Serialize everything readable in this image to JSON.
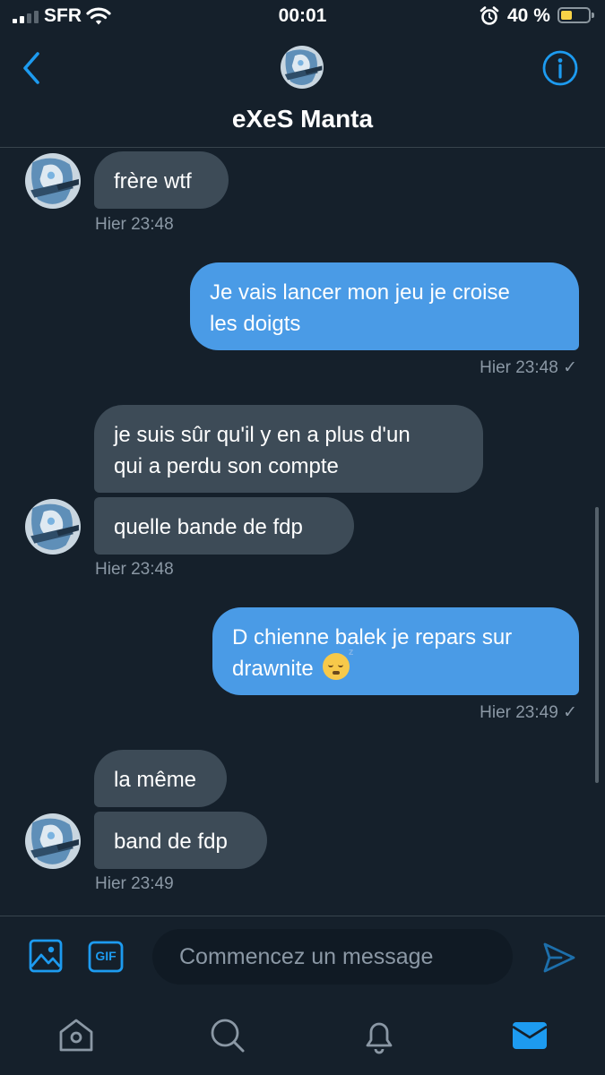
{
  "status_bar": {
    "carrier": "SFR",
    "time": "00:01",
    "battery_percent": "40 %",
    "battery_level": 0.4,
    "signal_bars": 2
  },
  "header": {
    "contact_name": "eXeS Manta",
    "back_icon": "chevron-left-icon",
    "info_icon": "info-icon"
  },
  "messages": [
    {
      "direction": "incoming",
      "text": "frère wtf"
    },
    {
      "direction": "incoming",
      "timestamp": "Hier 23:48"
    },
    {
      "direction": "outgoing",
      "lines": [
        "Je vais lancer mon jeu je croise",
        "les doigts"
      ]
    },
    {
      "direction": "outgoing",
      "timestamp": "Hier 23:48 ✓"
    },
    {
      "direction": "incoming",
      "lines": [
        "je suis sûr qu'il y en a plus d'un",
        "qui a perdu son compte"
      ]
    },
    {
      "direction": "incoming",
      "text": "quelle bande de fdp"
    },
    {
      "direction": "incoming",
      "timestamp": "Hier 23:48"
    },
    {
      "direction": "outgoing",
      "lines": [
        "D chienne balek je repars sur",
        "drawnite"
      ],
      "emoji": "sleeping-face"
    },
    {
      "direction": "outgoing",
      "timestamp": "Hier 23:49 ✓"
    },
    {
      "direction": "incoming",
      "text": "la même"
    },
    {
      "direction": "incoming",
      "text": "band de fdp"
    },
    {
      "direction": "incoming",
      "timestamp": "Hier 23:49"
    }
  ],
  "composer": {
    "placeholder": "Commencez un message",
    "gif_label": "GIF"
  },
  "tabbar": {
    "items": [
      "home-icon",
      "search-icon",
      "notifications-bell-icon",
      "messages-envelope-icon"
    ],
    "active": "messages-envelope-icon"
  },
  "colors": {
    "background": "#15202b",
    "incoming_bubble": "#3d4b57",
    "outgoing_bubble": "#4a9be6",
    "accent": "#1d9bf0",
    "muted_text": "#8b98a5"
  }
}
